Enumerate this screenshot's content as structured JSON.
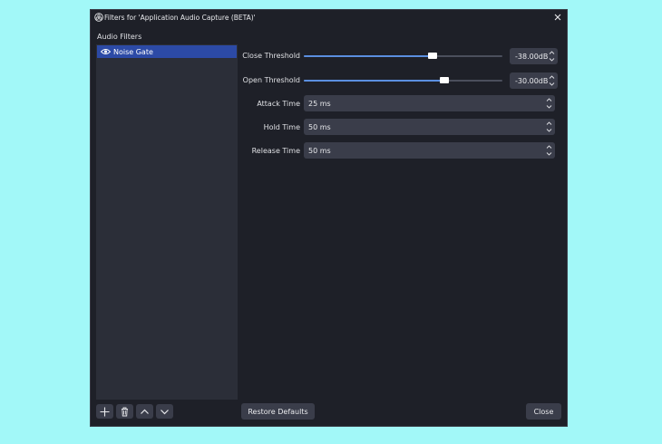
{
  "window": {
    "title": "Filters for 'Application Audio Capture (BETA)'"
  },
  "sidebar": {
    "section_label": "Audio Filters",
    "items": [
      {
        "label": "Noise Gate",
        "visible_icon": "eye-icon",
        "selected": true
      }
    ]
  },
  "settings": {
    "close_threshold": {
      "label": "Close Threshold",
      "value": "-38.00dB",
      "slider_fraction": 0.65
    },
    "open_threshold": {
      "label": "Open Threshold",
      "value": "-30.00dB",
      "slider_fraction": 0.71
    },
    "attack_time": {
      "label": "Attack Time",
      "value": "25 ms"
    },
    "hold_time": {
      "label": "Hold Time",
      "value": "50 ms"
    },
    "release_time": {
      "label": "Release Time",
      "value": "50 ms"
    }
  },
  "toolbar": {
    "add_icon": "plus-icon",
    "remove_icon": "trash-icon",
    "move_up_icon": "chevron-up-icon",
    "move_down_icon": "chevron-down-icon"
  },
  "buttons": {
    "restore_defaults": "Restore Defaults",
    "close": "Close"
  },
  "colors": {
    "page_background": "#a2f8f8",
    "window_background": "#1e2028",
    "panel_background": "#2b2e38",
    "selection": "#2c4aa6",
    "slider_fill": "#5b8fe0",
    "control": "#3a3d4a"
  }
}
